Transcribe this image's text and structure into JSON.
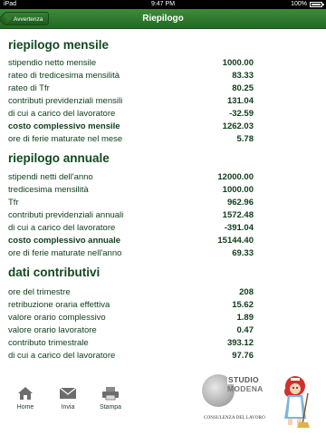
{
  "statusbar": {
    "device": "iPad",
    "time": "9:47 PM",
    "battery_pct": "100%"
  },
  "navbar": {
    "back_label": "Avvertenza",
    "title": "Riepilogo"
  },
  "sections": [
    {
      "title": "riepilogo mensile",
      "rows": [
        {
          "label": "stipendio netto mensile",
          "value": "1000.00",
          "bold": false
        },
        {
          "label": "rateo di tredicesima mensilità",
          "value": "83.33",
          "bold": false
        },
        {
          "label": "rateo di Tfr",
          "value": "80.25",
          "bold": false
        },
        {
          "label": "contributi previdenziali mensili",
          "value": "131.04",
          "bold": false
        },
        {
          "label": "di cui a carico del lavoratore",
          "value": "-32.59",
          "bold": false
        },
        {
          "label": "costo complessivo mensile",
          "value": "1262.03",
          "bold": true
        },
        {
          "label": "ore di ferie maturate nel mese",
          "value": "5.78",
          "bold": false
        }
      ]
    },
    {
      "title": "riepilogo annuale",
      "rows": [
        {
          "label": "stipendi netti dell'anno",
          "value": "12000.00",
          "bold": false
        },
        {
          "label": "tredicesima mensilità",
          "value": "1000.00",
          "bold": false
        },
        {
          "label": "Tfr",
          "value": "962.96",
          "bold": false
        },
        {
          "label": "contributi previdenziali annuali",
          "value": "1572.48",
          "bold": false
        },
        {
          "label": "di cui a carico del lavoratore",
          "value": "-391.04",
          "bold": false
        },
        {
          "label": "costo complessivo annuale",
          "value": "15144.40",
          "bold": true
        },
        {
          "label": "ore di ferie maturate nell'anno",
          "value": "69.33",
          "bold": false
        }
      ]
    },
    {
      "title": "dati contributivi",
      "rows": [
        {
          "label": "ore del trimestre",
          "value": "208",
          "bold": false
        },
        {
          "label": "retribuzione oraria effettiva",
          "value": "15.62",
          "bold": false
        },
        {
          "label": "valore orario complessivo",
          "value": "1.89",
          "bold": false
        },
        {
          "label": "valore orario lavoratore",
          "value": "0.47",
          "bold": false
        },
        {
          "label": "contributo trimestrale",
          "value": "393.12",
          "bold": false
        },
        {
          "label": "di cui a carico del lavoratore",
          "value": "97.76",
          "bold": false
        }
      ]
    }
  ],
  "footer": {
    "home_label": "Home",
    "invia_label": "Invia",
    "stampa_label": "Stampa",
    "logo_line1": "STUDIO",
    "logo_line2": "MODENA",
    "logo_tagline": "CONSULENZA DEL LAVORO"
  }
}
